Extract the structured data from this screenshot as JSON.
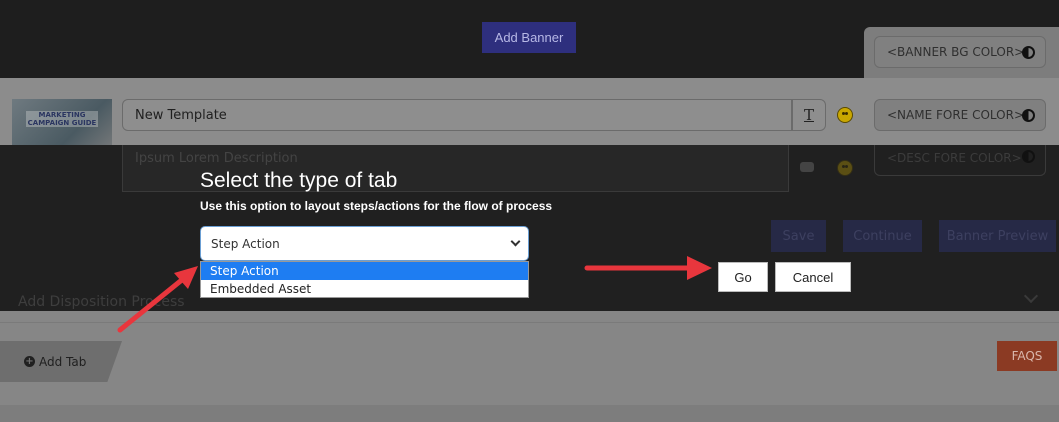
{
  "banner": {
    "add_banner_label": "Add Banner",
    "bg_color_label": "<BANNER BG COLOR>"
  },
  "template": {
    "thumbnail_line1": "MARKETING",
    "thumbnail_line2": "CAMPAIGN GUIDE",
    "name_value": "New Template",
    "name_fore_color_label": "<NAME FORE COLOR>",
    "description_value": "Ipsum Lorem Description",
    "desc_fore_color_label": "<DESC FORE COLOR>"
  },
  "actions": {
    "save": "Save",
    "continue": "Continue",
    "banner_preview": "Banner Preview"
  },
  "disposition": {
    "label": "Add Disposition Process"
  },
  "tabs": {
    "add_tab_label": "Add Tab",
    "faqs_label": "FAQS"
  },
  "modal": {
    "title": "Select the type of tab",
    "subtitle": "Use this option to layout steps/actions for the flow of process",
    "select_value": "Step Action",
    "options": [
      "Step Action",
      "Embedded Asset"
    ],
    "go_label": "Go",
    "cancel_label": "Cancel"
  },
  "colors": {
    "arrow": "#e8363d",
    "accent": "#1e7df2",
    "banner_button": "#2e2f7e",
    "faqs": "#8b3a23"
  }
}
